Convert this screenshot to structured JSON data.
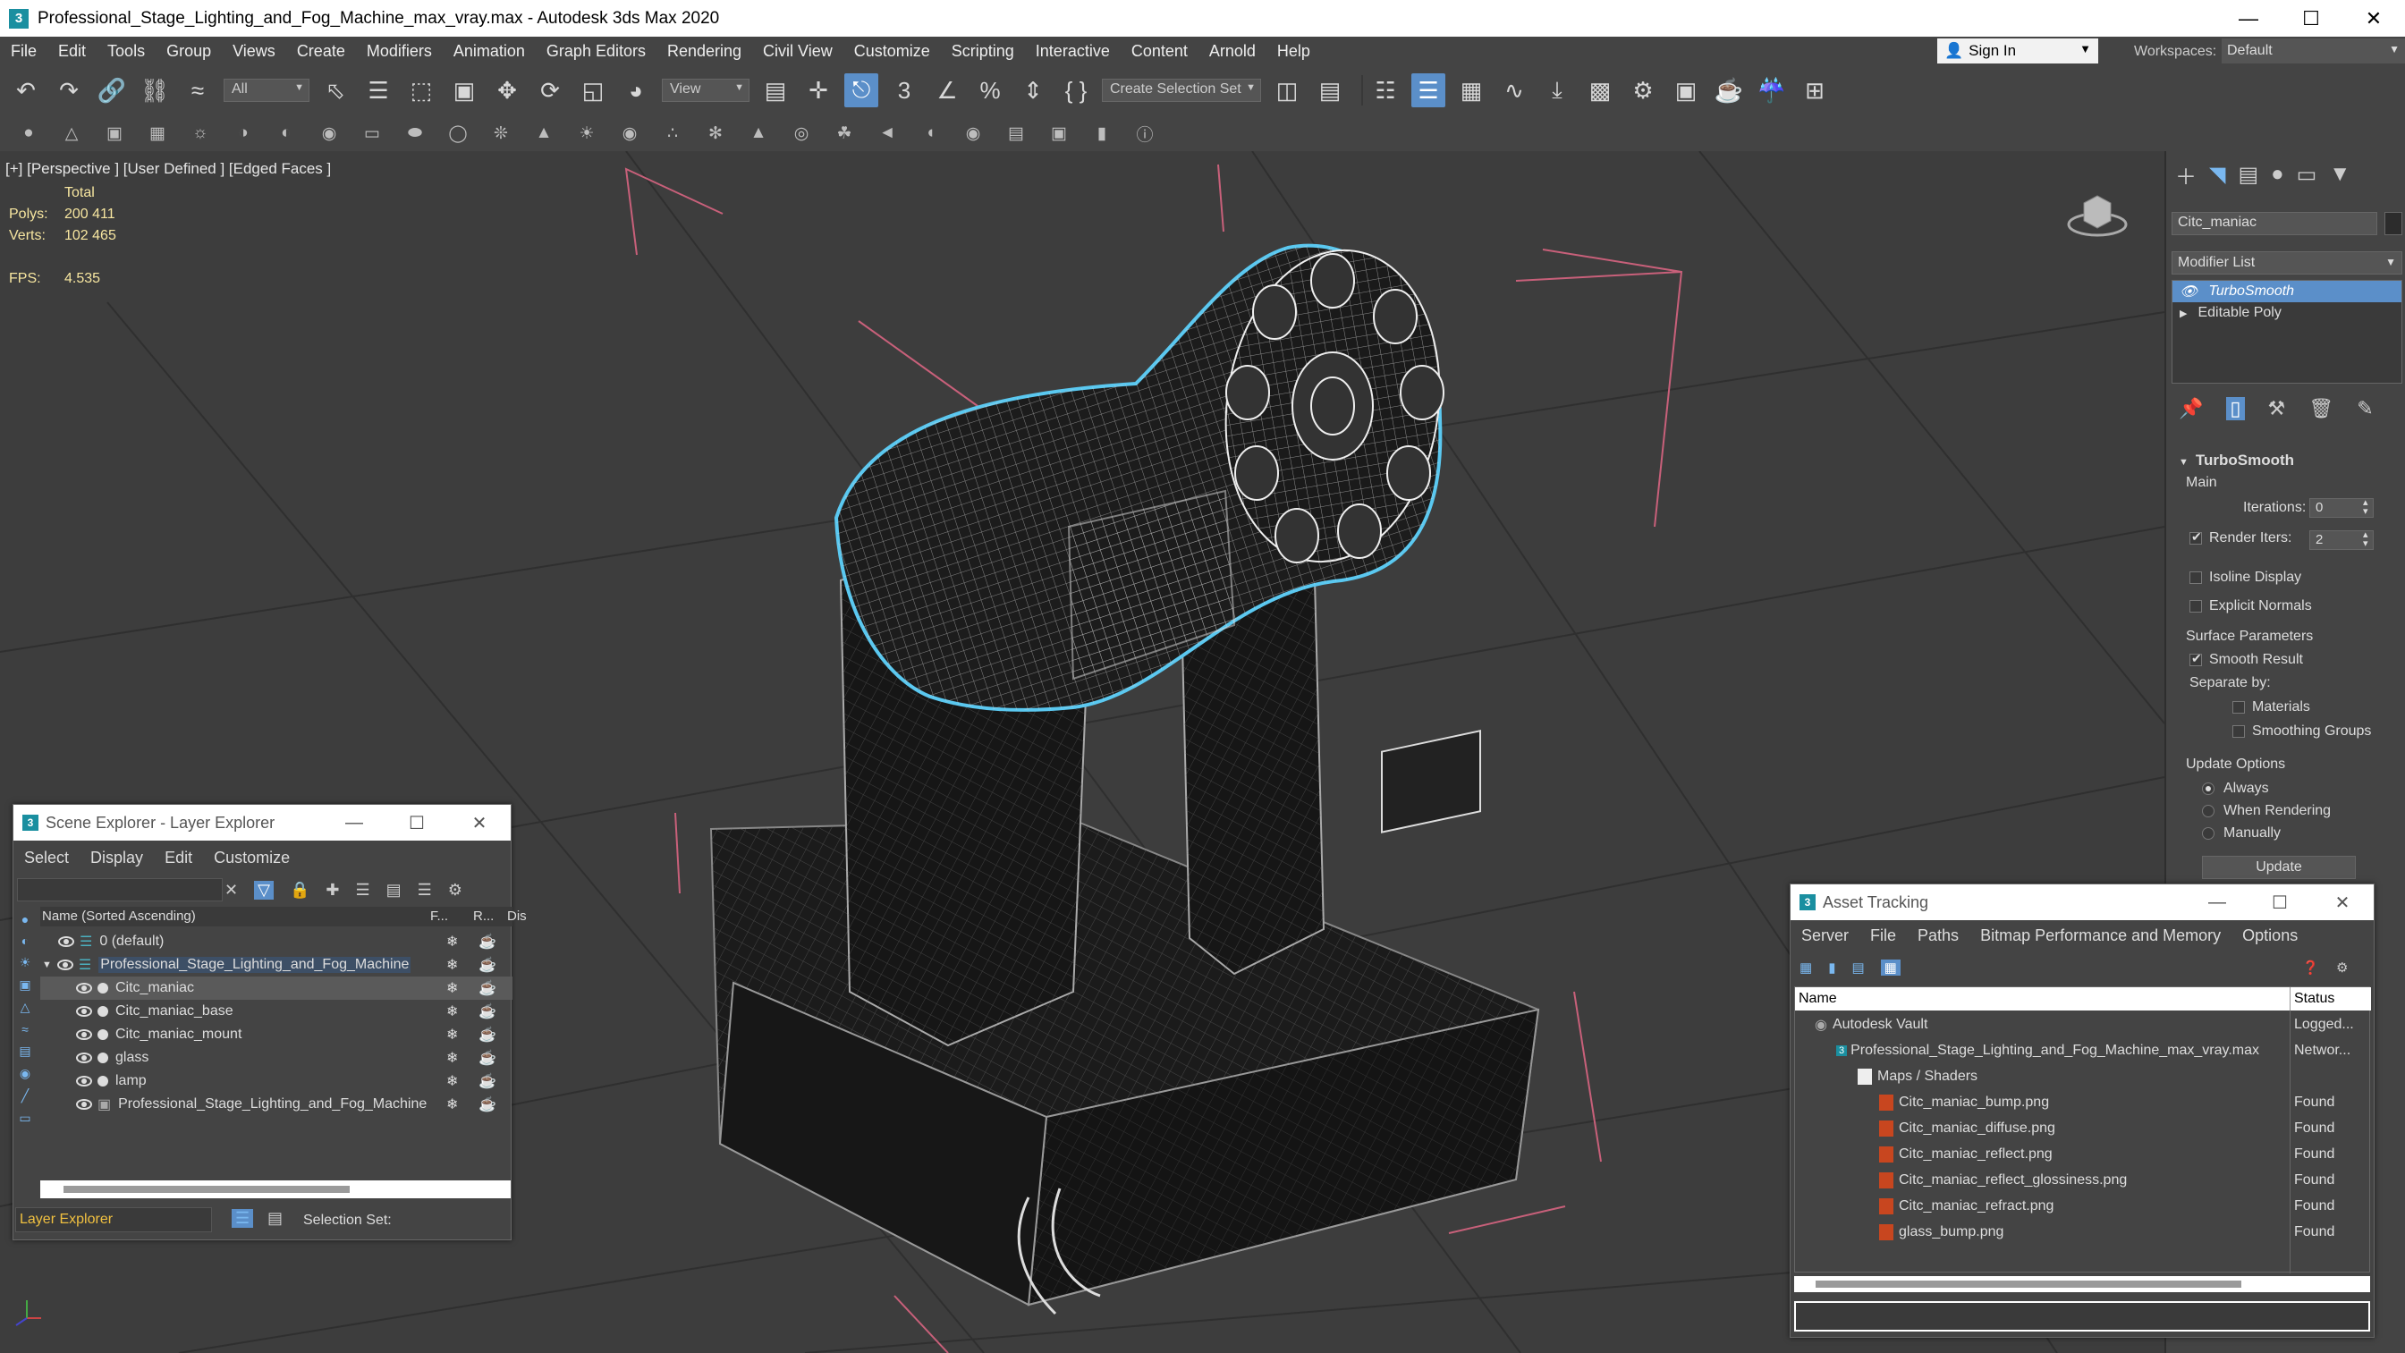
{
  "window": {
    "title": "Professional_Stage_Lighting_and_Fog_Machine_max_vray.max - Autodesk 3ds Max 2020",
    "app_icon": "3"
  },
  "menu": [
    "File",
    "Edit",
    "Tools",
    "Group",
    "Views",
    "Create",
    "Modifiers",
    "Animation",
    "Graph Editors",
    "Rendering",
    "Civil View",
    "Customize",
    "Scripting",
    "Interactive",
    "Content",
    "Arnold",
    "Help"
  ],
  "signin": {
    "label": "Sign In"
  },
  "workspace": {
    "label": "Workspaces:",
    "value": "Default"
  },
  "toolbar": {
    "filter_all": "All",
    "ref_coord": "View",
    "named_selection": "Create Selection Set",
    "snap_labels": {
      "angle": "3",
      "percent": "%"
    }
  },
  "viewport": {
    "label": "[+] [Perspective ] [User Defined ] [Edged Faces ]",
    "stats": {
      "total_label": "Total",
      "polys_label": "Polys:",
      "polys_value": "200 411",
      "verts_label": "Verts:",
      "verts_value": "102 465",
      "fps_label": "FPS:",
      "fps_value": "4.535"
    }
  },
  "command_panel": {
    "object_name": "Citc_maniac",
    "modifier_list_label": "Modifier List",
    "stack": [
      "TurboSmooth",
      "Editable Poly"
    ],
    "rollout_title": "TurboSmooth",
    "main_label": "Main",
    "iterations_label": "Iterations:",
    "iterations_value": "0",
    "render_iters_label": "Render Iters:",
    "render_iters_value": "2",
    "isoline_label": "Isoline Display",
    "explicit_normals_label": "Explicit Normals",
    "surface_params_label": "Surface Parameters",
    "smooth_result_label": "Smooth Result",
    "separate_by_label": "Separate by:",
    "materials_label": "Materials",
    "smoothing_groups_label": "Smoothing Groups",
    "update_options_label": "Update Options",
    "always_label": "Always",
    "when_rendering_label": "When Rendering",
    "manually_label": "Manually",
    "update_button": "Update"
  },
  "scene_explorer": {
    "title": "Scene Explorer - Layer Explorer",
    "menu": [
      "Select",
      "Display",
      "Edit",
      "Customize"
    ],
    "col_name": "Name (Sorted Ascending)",
    "col_f": "F...",
    "col_r": "R...",
    "col_dis": "Dis",
    "rows": [
      {
        "label": "0 (default)",
        "indent": 0
      },
      {
        "label": "Professional_Stage_Lighting_and_Fog_Machine",
        "indent": 0
      },
      {
        "label": "Citc_maniac",
        "indent": 1
      },
      {
        "label": "Citc_maniac_base",
        "indent": 1
      },
      {
        "label": "Citc_maniac_mount",
        "indent": 1
      },
      {
        "label": "glass",
        "indent": 1
      },
      {
        "label": "lamp",
        "indent": 1
      },
      {
        "label": "Professional_Stage_Lighting_and_Fog_Machine",
        "indent": 1
      }
    ],
    "footer_dropdown": "Layer Explorer",
    "selection_set_label": "Selection Set:"
  },
  "asset_tracking": {
    "title": "Asset Tracking",
    "menu": [
      "Server",
      "File",
      "Paths",
      "Bitmap Performance and Memory",
      "Options"
    ],
    "col_name": "Name",
    "col_status": "Status",
    "rows": [
      {
        "name": "Autodesk Vault",
        "status": "Logged..."
      },
      {
        "name": "Professional_Stage_Lighting_and_Fog_Machine_max_vray.max",
        "status": "Networ..."
      },
      {
        "name": "Maps / Shaders",
        "status": ""
      },
      {
        "name": "Citc_maniac_bump.png",
        "status": "Found"
      },
      {
        "name": "Citc_maniac_diffuse.png",
        "status": "Found"
      },
      {
        "name": "Citc_maniac_reflect.png",
        "status": "Found"
      },
      {
        "name": "Citc_maniac_reflect_glossiness.png",
        "status": "Found"
      },
      {
        "name": "Citc_maniac_refract.png",
        "status": "Found"
      },
      {
        "name": "glass_bump.png",
        "status": "Found"
      }
    ]
  },
  "colors": {
    "selection_highlight": "#5ac8f0",
    "bbox_lines": "#c8607a",
    "stat_text": "#f7e6a0",
    "active_button": "#5b8fc9"
  }
}
